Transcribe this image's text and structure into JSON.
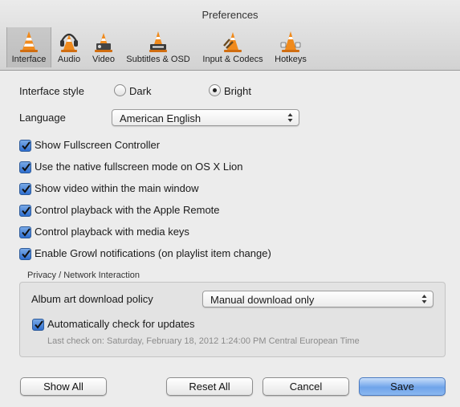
{
  "window": {
    "title": "Preferences"
  },
  "toolbar": {
    "items": [
      {
        "label": "Interface",
        "icon": "cone-icon",
        "selected": true
      },
      {
        "label": "Audio",
        "icon": "headphones-cone-icon",
        "selected": false
      },
      {
        "label": "Video",
        "icon": "video-cone-icon",
        "selected": false
      },
      {
        "label": "Subtitles & OSD",
        "icon": "subtitles-cone-icon",
        "selected": false
      },
      {
        "label": "Input & Codecs",
        "icon": "input-cone-icon",
        "selected": false
      },
      {
        "label": "Hotkeys",
        "icon": "hotkeys-cone-icon",
        "selected": false
      }
    ]
  },
  "interface_style": {
    "label": "Interface style",
    "options": [
      {
        "label": "Dark",
        "selected": false
      },
      {
        "label": "Bright",
        "selected": true
      }
    ]
  },
  "language": {
    "label": "Language",
    "value": "American English"
  },
  "checkboxes": [
    {
      "label": "Show Fullscreen Controller",
      "checked": true
    },
    {
      "label": "Use the native fullscreen mode on OS X Lion",
      "checked": true
    },
    {
      "label": "Show video within the main window",
      "checked": true
    },
    {
      "label": "Control playback with the Apple Remote",
      "checked": true
    },
    {
      "label": "Control playback with media keys",
      "checked": true
    },
    {
      "label": "Enable Growl notifications (on playlist item change)",
      "checked": true
    }
  ],
  "privacy": {
    "title": "Privacy / Network Interaction",
    "album_art_label": "Album art download policy",
    "album_art_value": "Manual download only",
    "auto_update_label": "Automatically check for updates",
    "auto_update_checked": true,
    "last_check": "Last check on: Saturday, February 18, 2012 1:24:00 PM Central European Time"
  },
  "buttons": {
    "show_all": "Show All",
    "reset_all": "Reset All",
    "cancel": "Cancel",
    "save": "Save"
  },
  "colors": {
    "cone_orange": "#f08a1c",
    "checkbox_blue": "#2f6fd0",
    "default_button_blue": "#6fa4ea"
  }
}
